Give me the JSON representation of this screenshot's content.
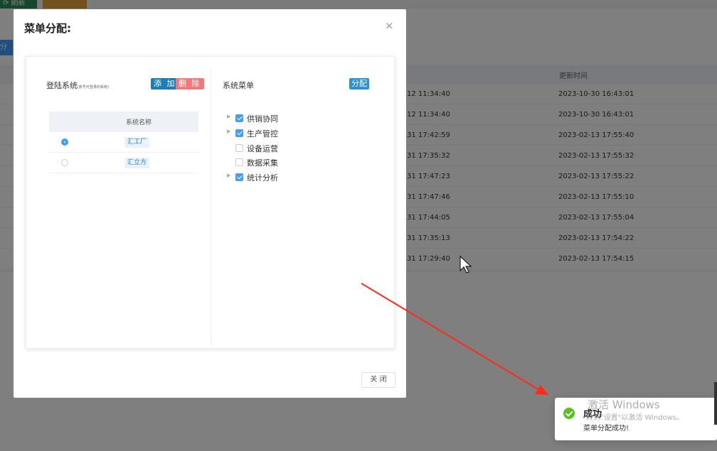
{
  "background": {
    "toolbar": {
      "refresh_label": "⟳ 刷新",
      "blue_button_label": "分配"
    },
    "table": {
      "update_time_header": "更新时间",
      "rows": [
        {
          "create_time": "12 11:34:40",
          "update_time": "2023-10-30 16:43:01"
        },
        {
          "create_time": "12 11:34:40",
          "update_time": "2023-10-30 16:43:01"
        },
        {
          "create_time": "31 17:42:59",
          "update_time": "2023-02-13 17:55:40"
        },
        {
          "create_time": "31 17:35:32",
          "update_time": "2023-02-13 17:55:32"
        },
        {
          "create_time": "31 17:47:23",
          "update_time": "2023-02-13 17:55:22"
        },
        {
          "create_time": "31 17:47:46",
          "update_time": "2023-02-13 17:55:10"
        },
        {
          "create_time": "31 17:44:05",
          "update_time": "2023-02-13 17:55:04"
        },
        {
          "create_time": "31 17:35:13",
          "update_time": "2023-02-13 17:54:22"
        },
        {
          "create_time": "31 17:29:40",
          "update_time": "2023-02-13 17:54:15"
        }
      ]
    }
  },
  "dialog": {
    "title": "菜单分配:",
    "close_icon": "×",
    "close_button_label": "关 闭",
    "left": {
      "title": "登陆系统",
      "subtitle": "(账号可登录的系统)",
      "add_label": "添 加",
      "delete_label": "删 除",
      "column_header": "系统名称",
      "rows": [
        {
          "name": "汇工厂",
          "selected": true
        },
        {
          "name": "汇立方",
          "selected": false
        }
      ]
    },
    "right": {
      "title": "系统菜单",
      "assign_label": "分配",
      "tree": [
        {
          "label": "供销协同",
          "checked": true,
          "expandable": true
        },
        {
          "label": "生产管控",
          "checked": true,
          "expandable": true
        },
        {
          "label": "设备运营",
          "checked": false,
          "expandable": false
        },
        {
          "label": "数据采集",
          "checked": false,
          "expandable": false
        },
        {
          "label": "统计分析",
          "checked": true,
          "expandable": true
        }
      ]
    }
  },
  "toast": {
    "title": "成功",
    "message": "菜单分配成功!",
    "status_color": "#52c41a"
  },
  "watermark": {
    "line1": "激活 Windows",
    "line2": "转到\"设置\"以激活 Windows。"
  },
  "annotation": {
    "arrow_color": "#ff2a1a"
  }
}
